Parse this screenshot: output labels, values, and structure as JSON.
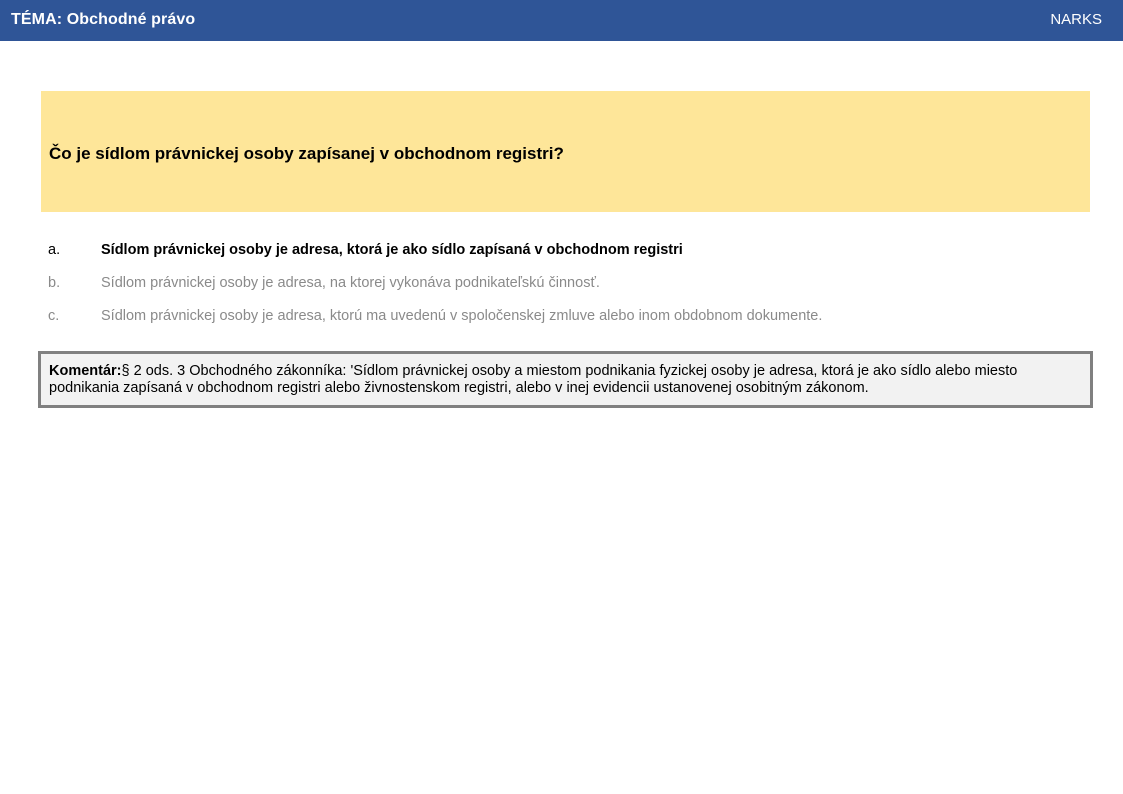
{
  "header": {
    "title": "TÉMA: Obchodné právo",
    "brand": "NARKS"
  },
  "question": {
    "text": "Čo je sídlom právnickej osoby zapísanej v obchodnom registri?"
  },
  "answers": [
    {
      "letter": "a.",
      "text": "Sídlom právnickej osoby je adresa, ktorá je ako sídlo zapísaná v obchodnom registri",
      "correct": true
    },
    {
      "letter": "b.",
      "text": "Sídlom právnickej osoby je adresa, na ktorej vykonáva podnikateľskú činnosť.",
      "correct": false
    },
    {
      "letter": "c.",
      "text": "Sídlom právnickej osoby je adresa, ktorú ma uvedenú v spoločenskej zmluve alebo inom obdobnom dokumente.",
      "correct": false
    }
  ],
  "comment": {
    "label": "Komentár:",
    "text": "§ 2 ods. 3 Obchodného zákonníka: 'Sídlom právnickej osoby a miestom podnikania fyzickej osoby je adresa, ktorá je ako sídlo alebo miesto podnikania zapísaná v obchodnom registri alebo živnostenskom registri, alebo v inej evidencii ustanovenej osobitným zákonom."
  },
  "colors": {
    "header_bg": "#2f5597",
    "question_bg": "#fee699",
    "comment_bg": "#f2f2f2",
    "comment_border": "#808080",
    "incorrect_text": "#8a8a8a"
  }
}
